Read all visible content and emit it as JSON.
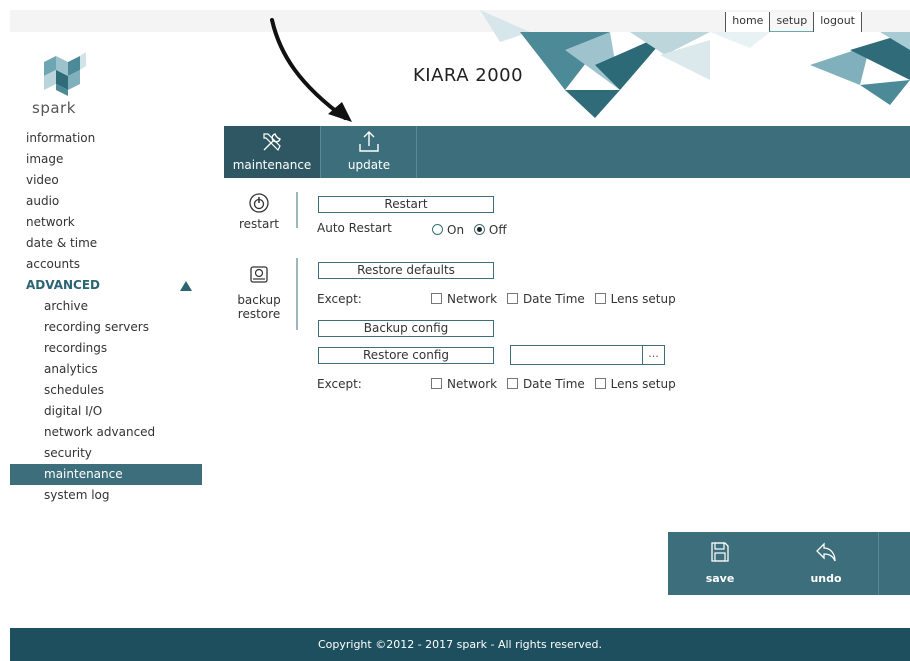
{
  "header": {
    "title": "KIARA 2000",
    "logo_text": "spark",
    "links": [
      "home",
      "setup",
      "logout"
    ],
    "active_link": "setup"
  },
  "sidebar": {
    "items": [
      {
        "label": "information"
      },
      {
        "label": "image"
      },
      {
        "label": "video"
      },
      {
        "label": "audio"
      },
      {
        "label": "network"
      },
      {
        "label": "date & time"
      },
      {
        "label": "accounts"
      }
    ],
    "section": {
      "label": "ADVANCED"
    },
    "sub_items": [
      {
        "label": "archive"
      },
      {
        "label": "recording servers"
      },
      {
        "label": "recordings"
      },
      {
        "label": "analytics"
      },
      {
        "label": "schedules"
      },
      {
        "label": "digital I/O"
      },
      {
        "label": "network advanced"
      },
      {
        "label": "security"
      },
      {
        "label": "maintenance"
      },
      {
        "label": "system log"
      }
    ],
    "active": "maintenance"
  },
  "tabs": [
    {
      "label": "maintenance",
      "icon": "tools-icon",
      "active": true
    },
    {
      "label": "update",
      "icon": "upload-icon",
      "active": false
    }
  ],
  "restart": {
    "section_label": "restart",
    "icon": "power-icon",
    "button": "Restart",
    "auto_restart_label": "Auto Restart",
    "options": [
      "On",
      "Off"
    ],
    "selected": "Off"
  },
  "backup": {
    "section_label_1": "backup",
    "section_label_2": "restore",
    "icon": "disk-icon",
    "restore_defaults": "Restore defaults",
    "except_label": "Except:",
    "except_options": [
      "Network",
      "Date Time",
      "Lens setup"
    ],
    "backup_config": "Backup config",
    "restore_config": "Restore config",
    "file_value": "",
    "browse_label": "...",
    "except_label_2": "Except:",
    "except_options_2": [
      "Network",
      "Date Time",
      "Lens setup"
    ]
  },
  "actions": {
    "save": "save",
    "undo": "undo"
  },
  "footer": {
    "copyright": "Copyright ©2012 - 2017 spark - All rights reserved."
  },
  "colors": {
    "accent": "#3c6e7b",
    "accent_dark": "#2e5763",
    "footer": "#1e4f5e",
    "section": "#2b6473"
  }
}
